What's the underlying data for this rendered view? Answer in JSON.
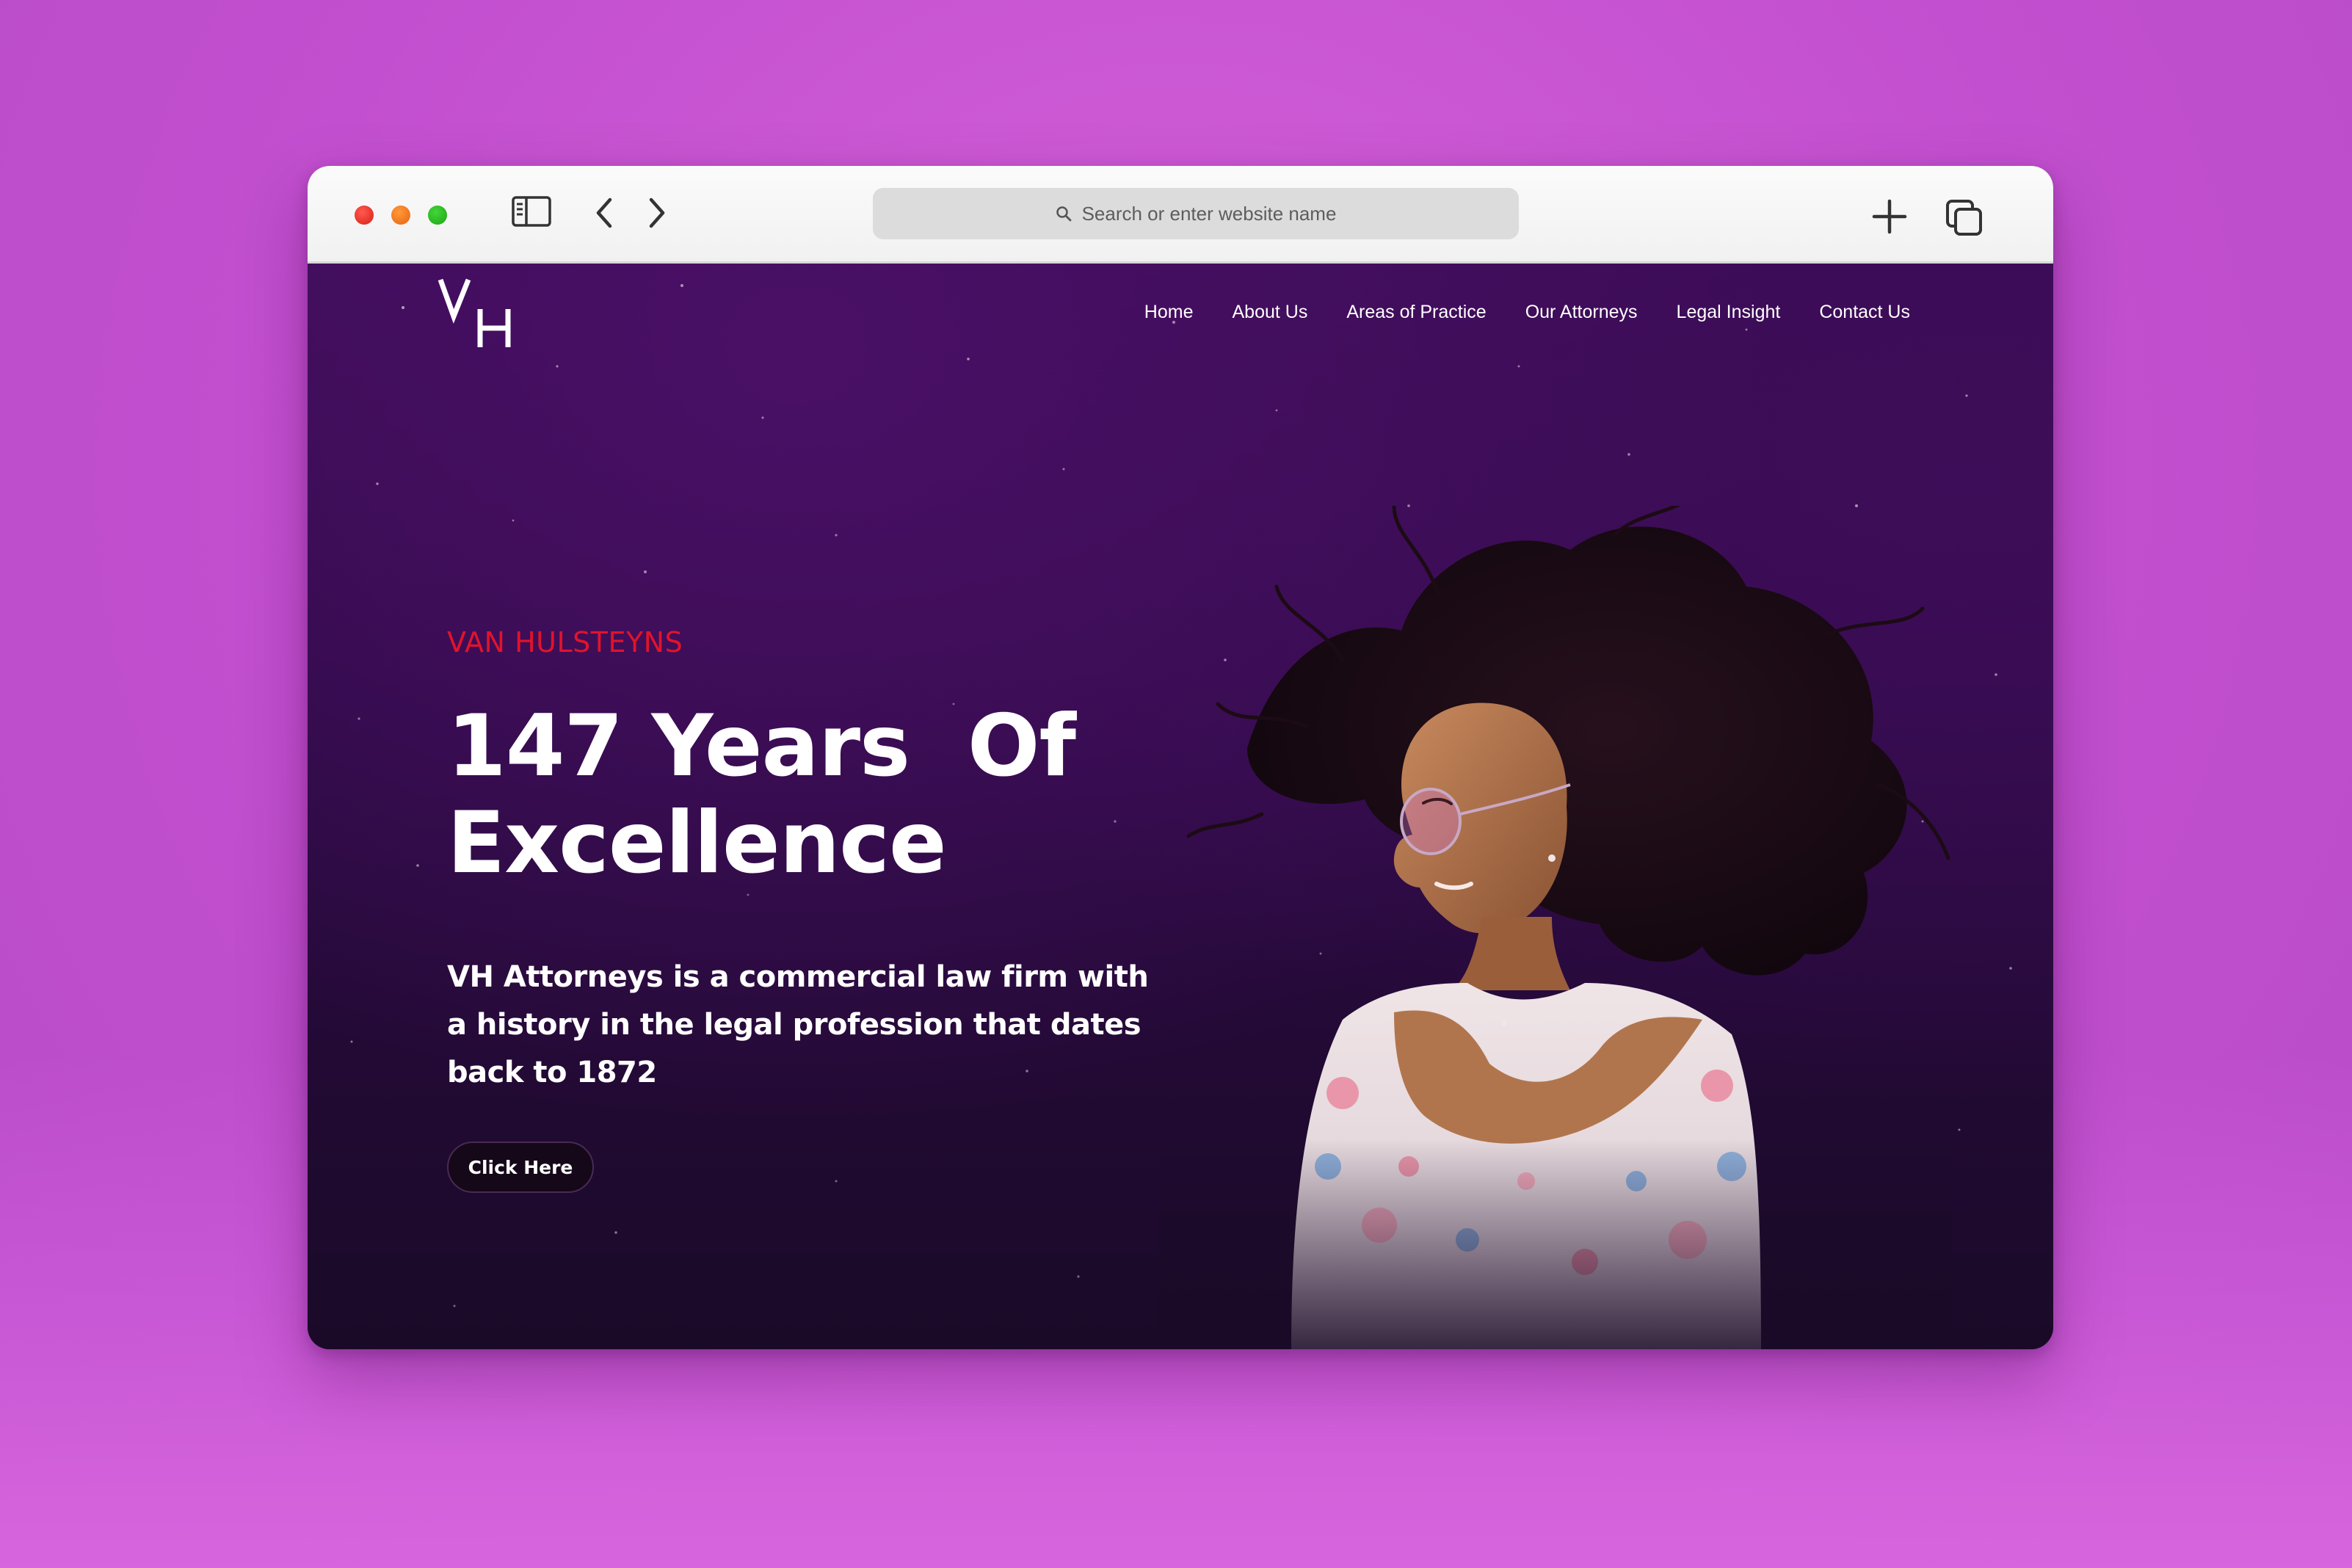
{
  "browser": {
    "search_placeholder": "Search or enter website name",
    "traffic_lights": [
      "#e0271d",
      "#f27420",
      "#2bc024"
    ]
  },
  "site": {
    "logo_text": "VH",
    "nav": [
      "Home",
      "About Us",
      "Areas of Practice",
      "Our Attorneys",
      "Legal Insight",
      "Contact Us"
    ],
    "hero": {
      "brand": "VAN HULSTEYNS",
      "headline_line1": "147 Years  Of",
      "headline_line2": "Excellence",
      "description": "VH Attorneys is a commercial law firm with a history in the legal profession that dates back to 1872",
      "cta": "Click Here"
    },
    "colors": {
      "brand_red": "#e1132b",
      "hero_purple": "#3b0b56",
      "page_background": "#c85ad2"
    }
  }
}
